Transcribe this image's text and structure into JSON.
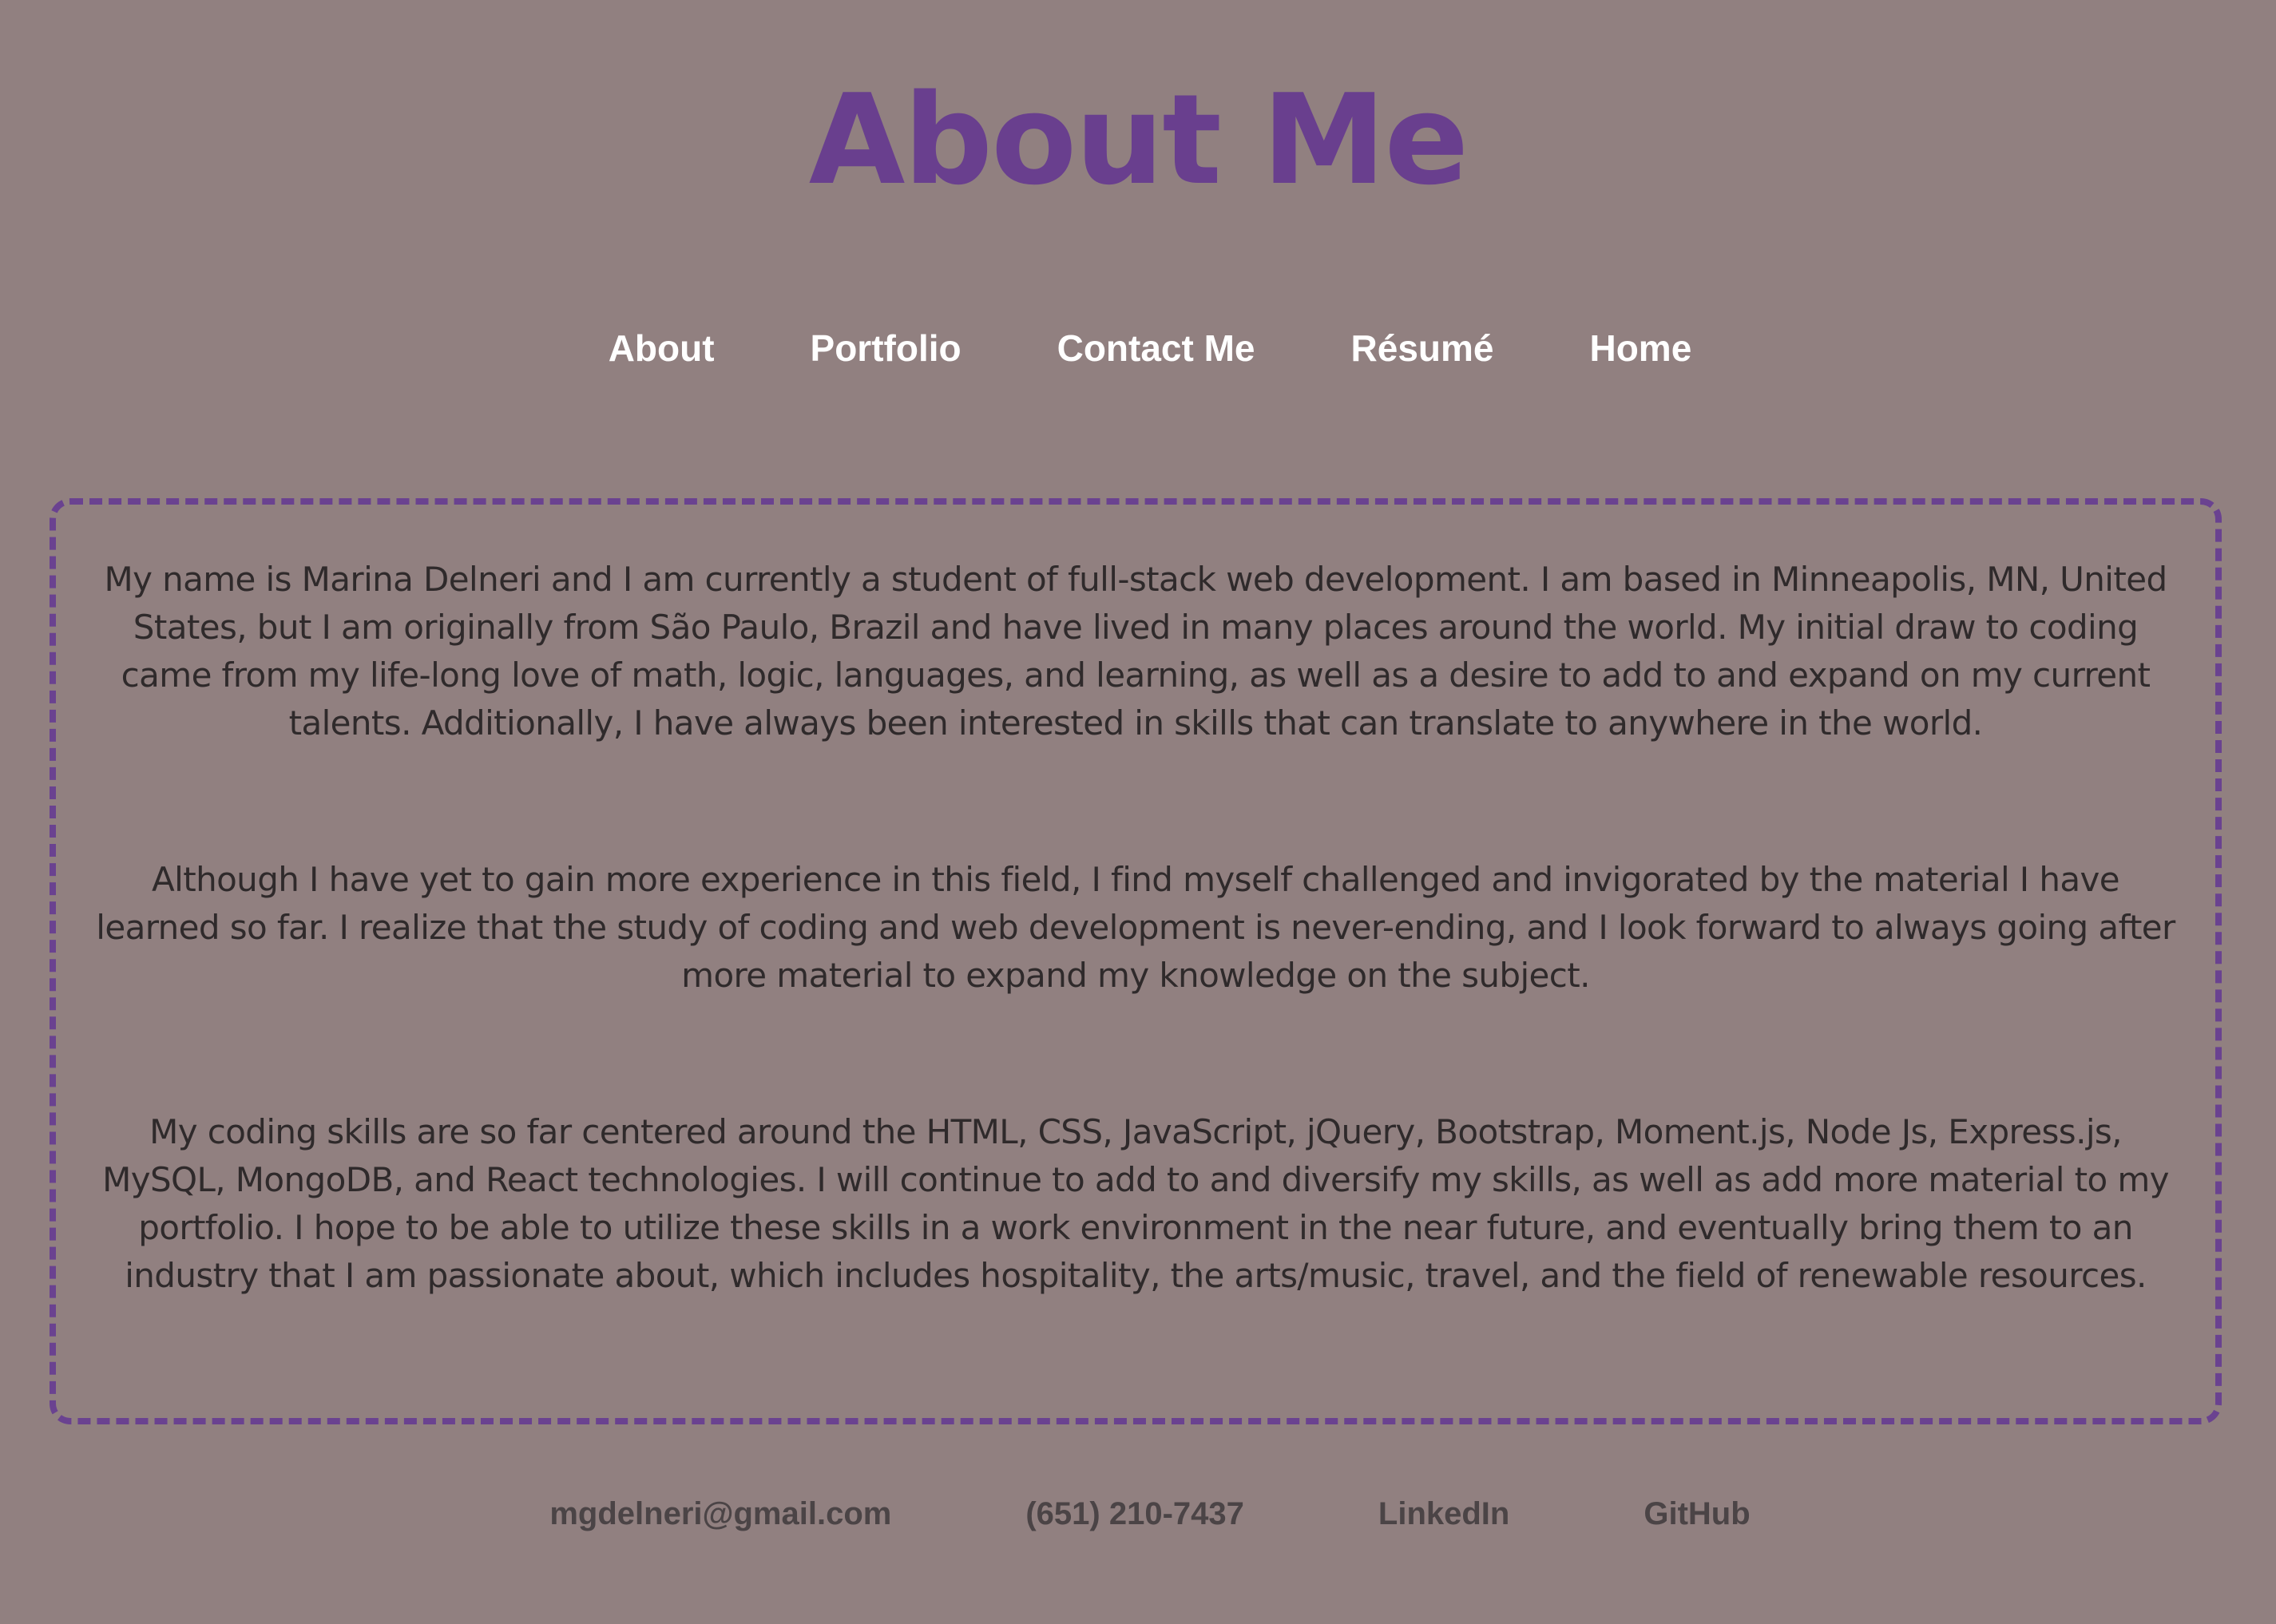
{
  "header": {
    "title": "About Me"
  },
  "nav": {
    "items": [
      {
        "label": "About"
      },
      {
        "label": "Portfolio"
      },
      {
        "label": "Contact Me"
      },
      {
        "label": "Résumé"
      },
      {
        "label": "Home"
      }
    ]
  },
  "main": {
    "paragraphs": [
      "My name is Marina Delneri and I am currently a student of full-stack web development. I am based in Minneapolis, MN, United States, but I am originally from São Paulo, Brazil and have lived in many places around the world. My initial draw to coding came from my life-long love of math, logic, languages, and learning, as well as a desire to add to and expand on my current talents. Additionally, I have always been interested in skills that can translate to anywhere in the world.",
      "Although I have yet to gain more experience in this field, I find myself challenged and invigorated by the material I have learned so far. I realize that the study of coding and web development is never-ending, and I look forward to always going after more material to expand my knowledge on the subject.",
      "My coding skills are so far centered around the HTML, CSS, JavaScript, jQuery, Bootstrap, Moment.js, Node Js, Express.js, MySQL, MongoDB, and React technologies. I will continue to add to and diversify my skills, as well as add more material to my portfolio. I hope to be able to utilize these skills in a work environment in the near future, and eventually bring them to an industry that I am passionate about, which includes hospitality, the arts/music, travel, and the field of renewable resources."
    ]
  },
  "footer": {
    "email": "mgdelneri@gmail.com",
    "phone": "(651) 210-7437",
    "linkedin": "LinkedIn",
    "github": "GitHub"
  },
  "colors": {
    "background": "#918080",
    "accent": "#693f8e",
    "nav_text": "#ffffff",
    "body_text": "#2f2a2b",
    "footer_text": "#4b4446"
  }
}
